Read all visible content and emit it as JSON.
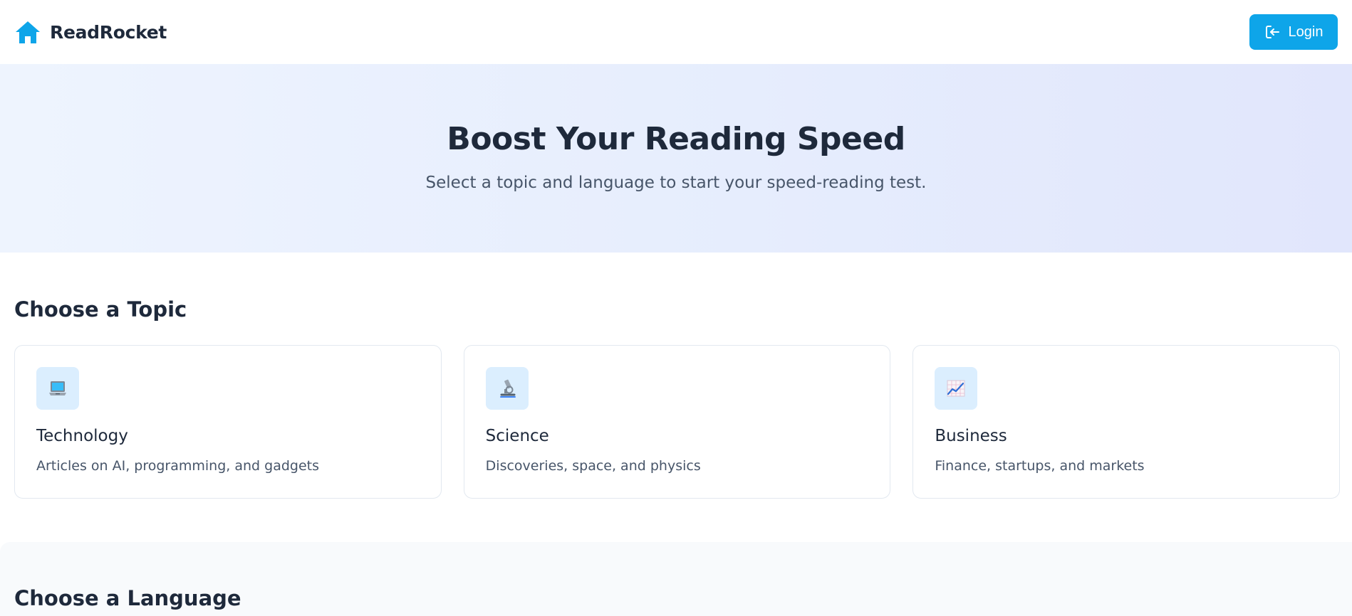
{
  "navbar": {
    "brand_icon": "home-icon",
    "brand_name": "ReadRocket",
    "login_icon": "login-icon",
    "login_label": "Login"
  },
  "hero": {
    "title": "Boost Your Reading Speed",
    "subtitle": "Select a topic and language to start your speed-reading test."
  },
  "topics": {
    "heading": "Choose a Topic",
    "items": [
      {
        "icon": "laptop-icon",
        "title": "Technology",
        "description": "Articles on AI, programming, and gadgets"
      },
      {
        "icon": "microscope-icon",
        "title": "Science",
        "description": "Discoveries, space, and physics"
      },
      {
        "icon": "chart-increasing-icon",
        "title": "Business",
        "description": "Finance, startups, and markets"
      }
    ]
  },
  "languages": {
    "heading": "Choose a Language"
  },
  "colors": {
    "accent": "#0ea5e9",
    "text_dark": "#1e293b",
    "text_muted": "#475569",
    "icon_bg": "#dbeefe",
    "hero_gradient_start": "#eef4fe",
    "hero_gradient_end": "#e1e6fc"
  }
}
